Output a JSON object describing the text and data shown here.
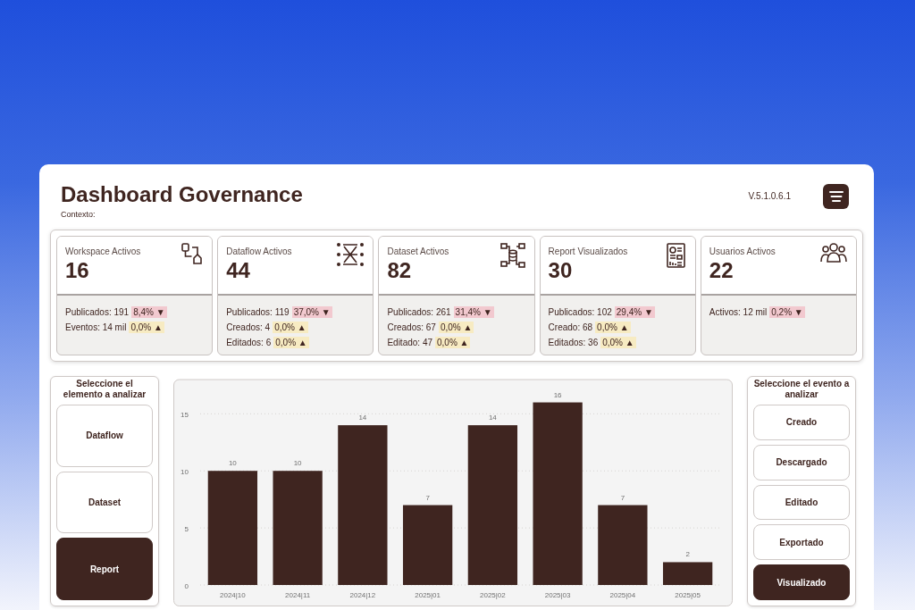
{
  "header": {
    "title": "Dashboard Governance",
    "context_label": "Contexto:",
    "version": "V.5.1.0.6.1"
  },
  "kpis": [
    {
      "title": "Workspace Activos",
      "value": "16",
      "metrics": [
        {
          "label": "Publicados: 191",
          "delta": "8,4% ▼",
          "kind": "down"
        },
        {
          "label": "Eventos: 14 mil",
          "delta": "0,0% ▲",
          "kind": "up"
        }
      ]
    },
    {
      "title": "Dataflow Activos",
      "value": "44",
      "metrics": [
        {
          "label": "Publicados: 119",
          "delta": "37,0% ▼",
          "kind": "down"
        },
        {
          "label": "Creados: 4",
          "delta": "0,0% ▲",
          "kind": "up"
        },
        {
          "label": "Editados: 6",
          "delta": "0,0% ▲",
          "kind": "up"
        }
      ]
    },
    {
      "title": "Dataset Activos",
      "value": "82",
      "metrics": [
        {
          "label": "Publicados: 261",
          "delta": "31,4% ▼",
          "kind": "down"
        },
        {
          "label": "Creados: 67",
          "delta": "0,0% ▲",
          "kind": "up"
        },
        {
          "label": "Editado: 47",
          "delta": "0,0% ▲",
          "kind": "up"
        }
      ]
    },
    {
      "title": "Report Visualizados",
      "value": "30",
      "metrics": [
        {
          "label": "Publicados: 102",
          "delta": "29,4% ▼",
          "kind": "down"
        },
        {
          "label": "Creado: 68",
          "delta": "0,0% ▲",
          "kind": "up"
        },
        {
          "label": "Editados: 36",
          "delta": "0,0% ▲",
          "kind": "up"
        }
      ]
    },
    {
      "title": "Usuarios Activos",
      "value": "22",
      "metrics": [
        {
          "label": "Activos: 12 mil",
          "delta": "0,2% ▼",
          "kind": "down"
        }
      ]
    }
  ],
  "element_selector": {
    "title": "Seleccione el elemento a analizar",
    "items": [
      {
        "label": "Dataflow",
        "selected": false
      },
      {
        "label": "Dataset",
        "selected": false
      },
      {
        "label": "Report",
        "selected": true
      }
    ]
  },
  "chart": {
    "chart_data": {
      "type": "bar",
      "categories": [
        "2024|10",
        "2024|11",
        "2024|12",
        "2025|01",
        "2025|02",
        "2025|03",
        "2025|04",
        "2025|05"
      ],
      "series": [
        {
          "color": "#3f2520",
          "values": [
            10,
            10,
            14,
            7,
            14,
            16,
            7,
            2
          ]
        }
      ],
      "ylim": [
        0,
        18
      ],
      "yticks": [
        0,
        5,
        10,
        15
      ],
      "grid": true,
      "data_labels": true
    }
  },
  "event_selector": {
    "title": "Seleccione el evento a analizar",
    "items": [
      {
        "label": "Creado",
        "selected": false
      },
      {
        "label": "Descargado",
        "selected": false
      },
      {
        "label": "Editado",
        "selected": false
      },
      {
        "label": "Exportado",
        "selected": false
      },
      {
        "label": "Visualizado",
        "selected": true
      }
    ]
  }
}
